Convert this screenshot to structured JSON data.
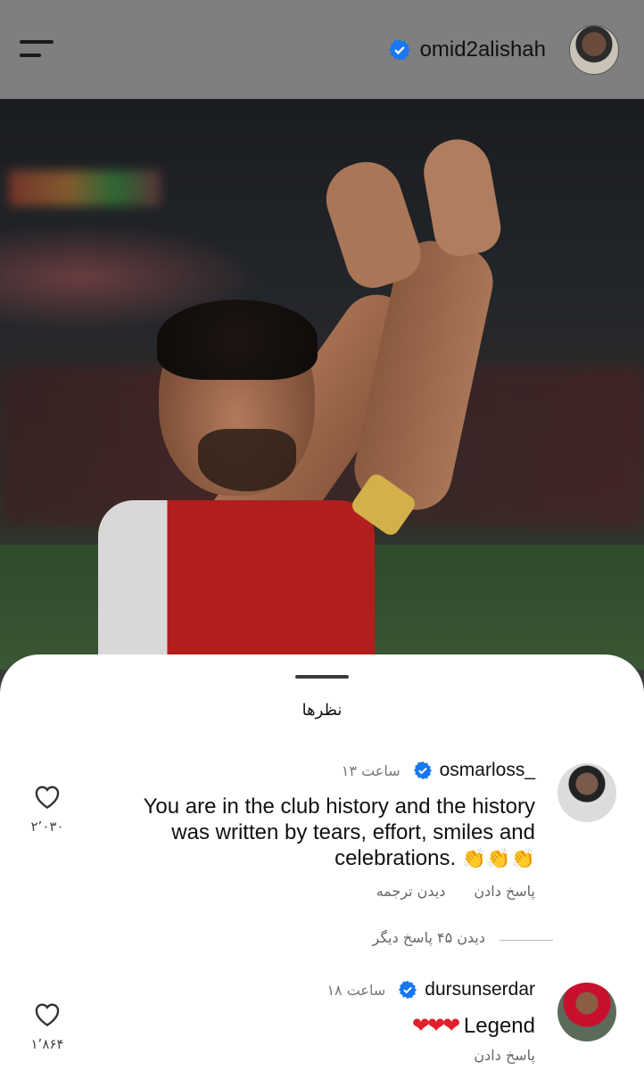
{
  "header": {
    "username": "omid2alishah",
    "verified": true,
    "menu_icon": "hamburger-menu-icon",
    "accent": "#1877f2"
  },
  "post": {
    "image": "player-applauding-photo"
  },
  "comments_sheet": {
    "title": "نظرها",
    "comments": [
      {
        "username": "osmarloss_",
        "verified": true,
        "time": "۱۳ ساعت",
        "text": "You are in the club history and the history was written by tears, effort, smiles and celebrations.",
        "emoji": "👏👏👏",
        "reply_label": "پاسخ دادن",
        "translate_label": "دیدن ترجمه",
        "like_count": "۲٬۰۳۰",
        "more_replies": "دیدن ۴۵ پاسخ دیگر"
      },
      {
        "username": "dursunserdar",
        "verified": true,
        "time": "۱۸ ساعت",
        "text": "Legend",
        "emoji": "❤❤❤",
        "reply_label": "پاسخ دادن",
        "like_count": "۱٬۸۶۴"
      }
    ]
  },
  "colors": {
    "header_bg": "#7f7f7f",
    "verified_blue": "#1877f2",
    "heart_red": "#e0202e"
  }
}
